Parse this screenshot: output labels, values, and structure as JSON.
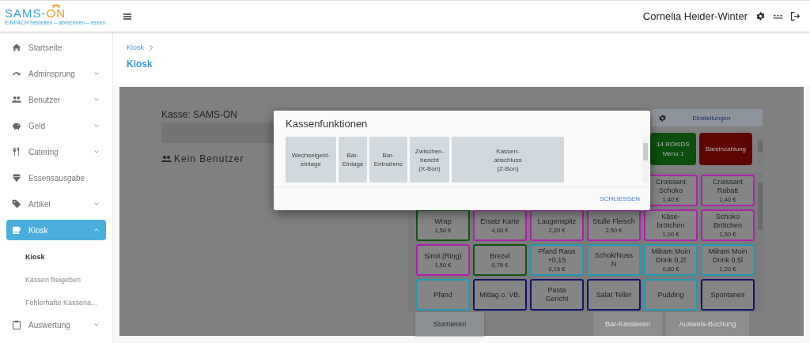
{
  "header": {
    "logo": {
      "primary": "SAMS-",
      "accent": "ON",
      "tagline": "EINFACH bestellen – abrechnen – essen"
    },
    "user_name": "Cornelia Heider-Winter"
  },
  "sidebar": {
    "items": [
      {
        "label": "Startseite",
        "expandable": false,
        "expanded": false,
        "selected": false
      },
      {
        "label": "Adminsprung",
        "expandable": true,
        "expanded": false,
        "selected": false
      },
      {
        "label": "Benutzer",
        "expandable": true,
        "expanded": false,
        "selected": false
      },
      {
        "label": "Geld",
        "expandable": true,
        "expanded": false,
        "selected": false
      },
      {
        "label": "Catering",
        "expandable": true,
        "expanded": false,
        "selected": false
      },
      {
        "label": "Essensausgabe",
        "expandable": false,
        "expanded": false,
        "selected": false
      },
      {
        "label": "Artikel",
        "expandable": true,
        "expanded": false,
        "selected": false
      },
      {
        "label": "Kiosk",
        "expandable": true,
        "expanded": true,
        "selected": true,
        "children": [
          {
            "label": "Kiosk",
            "selected": true
          },
          {
            "label": "Kassen freigeben",
            "selected": false
          },
          {
            "label": "Fehlerhafte Kassena...",
            "selected": false
          }
        ]
      },
      {
        "label": "Auswertung",
        "expandable": true,
        "expanded": false,
        "selected": false
      }
    ]
  },
  "breadcrumb": [
    "Kiosk"
  ],
  "page_title": "Kiosk",
  "kiosk": {
    "register_label": "Kasse: SAMS-ON",
    "user_status": "Kein Benutzer",
    "settings_button": "Einstellungen",
    "quick_tiles": [
      {
        "label": "14 ROKIDS\nMenu 1",
        "color": "#0c4f0c"
      },
      {
        "label": "Bareinzahlung",
        "color": "#5e0606"
      }
    ],
    "tile_rows": [
      [
        {
          "name": "Croissant\nSchoko",
          "price": "1,40 €",
          "color": "#b01fb0"
        },
        {
          "name": "Croissant\nRabatt",
          "price": "1,40 €",
          "color": "#b01fb0"
        }
      ],
      [
        {
          "name": "Wrap",
          "price": "1,50 €",
          "color": "#145214"
        },
        {
          "name": "Ersatz Karte",
          "price": "4,00 €",
          "color": "#b01fb0"
        },
        {
          "name": "Laugenspitz",
          "price": "2,20 €",
          "color": "#b01fb0"
        },
        {
          "name": "Stulle Fleisch",
          "price": "2,50 €",
          "color": "#b01fb0"
        },
        {
          "name": "Käse-\nbrötchen",
          "price": "1,00 €",
          "color": "#b01fb0"
        },
        {
          "name": "Schoko\nBrötchen",
          "price": "1,50 €",
          "color": "#b01fb0"
        }
      ],
      [
        {
          "name": "Simit (Ring)",
          "price": "1,50 €",
          "color": "#b01fb0"
        },
        {
          "name": "Brezel",
          "price": "0,75 €",
          "color": "#145214"
        },
        {
          "name": "Pfand Raus\n+0,15",
          "price": "0,15 €",
          "color": "#1e9ab8"
        },
        {
          "name": "Schok/Nuss\nN",
          "color": "#1e9ab8"
        },
        {
          "name": "Milram Moin\nDrink 0,2l",
          "price": "0,80 €",
          "color": "#1e9ab8"
        },
        {
          "name": "Milram Moin\nDrink 0,5l",
          "price": "1,20 €",
          "color": "#1e9ab8"
        }
      ],
      [
        {
          "name": "Pfand",
          "color": "#1e9ab8"
        },
        {
          "name": "Mittag o. VB.",
          "color": "#14146e"
        },
        {
          "name": "Pasta\nGericht",
          "color": "#14146e"
        },
        {
          "name": "Salat Teller",
          "color": "#14146e"
        },
        {
          "name": "Pudding",
          "color": "#1e9ab8"
        },
        {
          "name": "Spontanes",
          "color": "#14146e"
        }
      ]
    ],
    "actions": [
      {
        "label": "Stornieren",
        "disabled": false
      },
      {
        "label": "Bar-Kassieren",
        "disabled": true
      },
      {
        "label": "Ausweis-Buchung",
        "disabled": true
      }
    ]
  },
  "dialog": {
    "title": "Kassenfunktionen",
    "functions": [
      "Wechselgeld-\neinlage",
      "Bar-\nEinlage",
      "Bar-\nEntnahme",
      "Zwischen-\nbericht\n(X-Bon)",
      "Kassen-\nabschluss\n(Z-Bon)"
    ],
    "close_button": "SCHLIESSEN"
  }
}
